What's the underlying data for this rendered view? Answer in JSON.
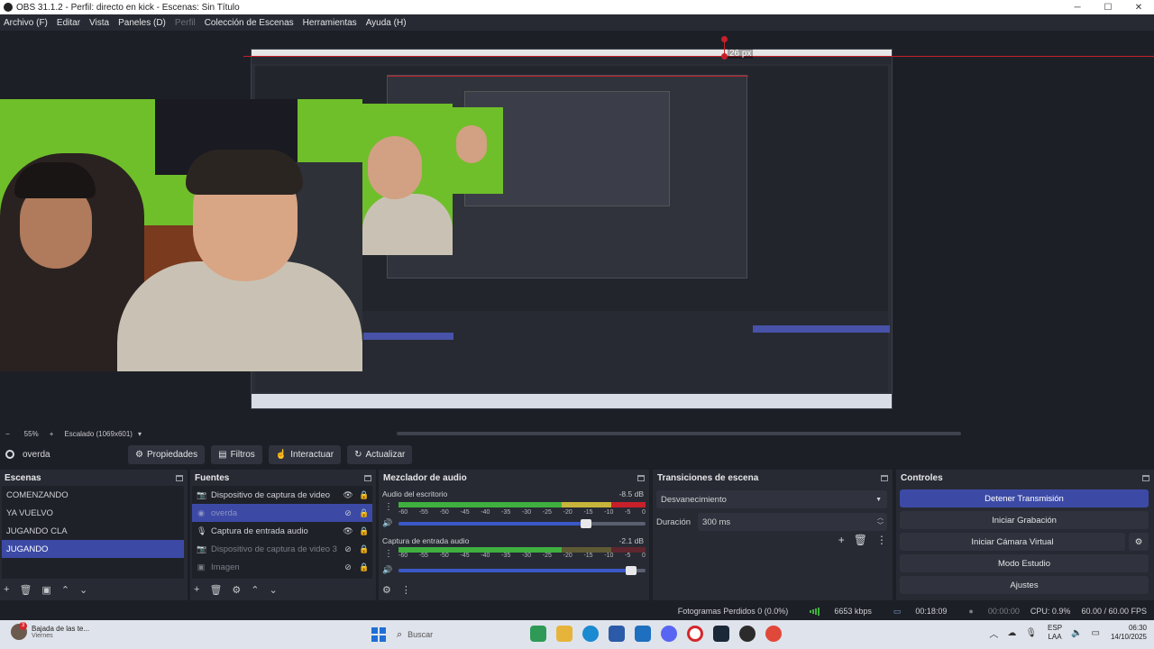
{
  "window": {
    "title": "OBS 31.1.2 - Perfil: directo en kick - Escenas: Sin Título",
    "minimize": "─",
    "maximize": "☐",
    "close": "✕"
  },
  "menu": [
    "Archivo (F)",
    "Editar",
    "Vista",
    "Paneles (D)",
    "Perfil",
    "Colección de Escenas",
    "Herramientas",
    "Ayuda (H)"
  ],
  "preview": {
    "size_label": "26 px"
  },
  "zoom": {
    "minus": "−",
    "value": "55%",
    "plus": "+",
    "scaling": "Escalado (1069x601)",
    "dropdown": "▾"
  },
  "source_toolbar": {
    "selected_source": "overda",
    "properties": "Propiedades",
    "filters": "Filtros",
    "interact": "Interactuar",
    "refresh": "Actualizar"
  },
  "scenes": {
    "title": "Escenas",
    "items": [
      {
        "label": "COMENZANDO",
        "selected": false
      },
      {
        "label": "YA VUELVO",
        "selected": false
      },
      {
        "label": "JUGANDO CLA",
        "selected": false
      },
      {
        "label": "JUGANDO",
        "selected": true
      }
    ],
    "footer": [
      "+",
      "🗑",
      "▣",
      "⌃",
      "⌄"
    ]
  },
  "sources": {
    "title": "Fuentes",
    "items": [
      {
        "label": "Dispositivo de captura de video",
        "icon": "📷",
        "visible": true,
        "selected": false,
        "dim": false
      },
      {
        "label": "overda",
        "icon": "◉",
        "visible": false,
        "selected": true,
        "dim": true
      },
      {
        "label": "Captura de entrada audio",
        "icon": "🎙",
        "visible": true,
        "selected": false,
        "dim": false
      },
      {
        "label": "Dispositivo de captura de video 3",
        "icon": "📷",
        "visible": false,
        "selected": false,
        "dim": true
      },
      {
        "label": "Imagen",
        "icon": "▣",
        "visible": false,
        "selected": false,
        "dim": true
      }
    ],
    "eye_on": "👁",
    "eye_off": "⊘",
    "lock": "🔒",
    "footer": [
      "+",
      "🗑",
      "⚙",
      "⌃",
      "⌄"
    ]
  },
  "mixer": {
    "title": "Mezclador de audio",
    "ticks": [
      "-60",
      "-55",
      "-50",
      "-45",
      "-40",
      "-35",
      "-30",
      "-25",
      "-20",
      "-15",
      "-10",
      "-5",
      "0"
    ],
    "channels": [
      {
        "name": "Audio del escritorio",
        "db": "-8.5 dB",
        "level": 0.88,
        "volume": 0.76
      },
      {
        "name": "Captura de entrada audio",
        "db": "-2.1 dB",
        "level": 0.45,
        "volume": 0.94
      }
    ],
    "footer": [
      "⚙",
      "⋮"
    ]
  },
  "transitions": {
    "title": "Transiciones de escena",
    "selected": "Desvanecimiento",
    "duration_label": "Duración",
    "duration_value": "300 ms",
    "icons": [
      "+",
      "🗑",
      "⋮"
    ]
  },
  "controls": {
    "title": "Controles",
    "buttons": [
      "Detener Transmisión",
      "Iniciar Grabación",
      "Iniciar Cámara Virtual",
      "Modo Estudio",
      "Ajustes"
    ],
    "gear": "⚙"
  },
  "status": {
    "dropped": "Fotogramas Perdidos 0 (0.0%)",
    "bitrate": "6653 kbps",
    "stream_time": "00:18:09",
    "record_time": "00:00:00",
    "cpu": "CPU: 0.9%",
    "fps": "60.00 / 60.00 FPS"
  },
  "taskbar": {
    "notif_title": "Bajada de las te...",
    "notif_sub": "Viernes",
    "notif_badge": "3",
    "search": "Buscar",
    "lang1": "ESP",
    "lang2": "LAA",
    "time": "06:30",
    "date": "14/10/2025"
  },
  "colors": {
    "accent": "#3c4aa6",
    "dock": "#272a33",
    "background": "#1d1f26",
    "meter_green": "#3fb03f",
    "meter_yellow": "#c7b43a",
    "meter_red": "#c8202a"
  }
}
